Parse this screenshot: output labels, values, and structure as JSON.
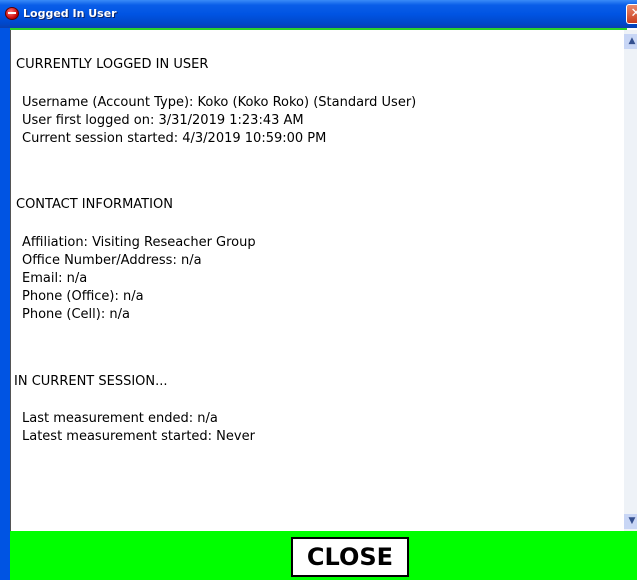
{
  "window": {
    "title": "Logged In User",
    "close_glyph": "✕",
    "icon": "app-icon"
  },
  "sections": {
    "current_user": {
      "heading": "CURRENTLY LOGGED IN USER",
      "lines": [
        "Username (Account Type): Koko (Koko Roko) (Standard User)",
        "User first logged on: 3/31/2019 1:23:43 AM",
        "Current session started: 4/3/2019 10:59:00 PM"
      ]
    },
    "contact": {
      "heading": "CONTACT INFORMATION",
      "lines": [
        "Affiliation: Visiting Reseacher Group",
        "Office Number/Address: n/a",
        "Email: n/a",
        "Phone (Office): n/a",
        "Phone (Cell): n/a"
      ]
    },
    "session": {
      "heading": "IN CURRENT SESSION...",
      "lines": [
        "Last measurement ended: n/a",
        "Latest measurement started: Never"
      ]
    }
  },
  "scrollbar": {
    "up_glyph": "▲",
    "down_glyph": "▼"
  },
  "footer": {
    "close_label": "CLOSE"
  }
}
